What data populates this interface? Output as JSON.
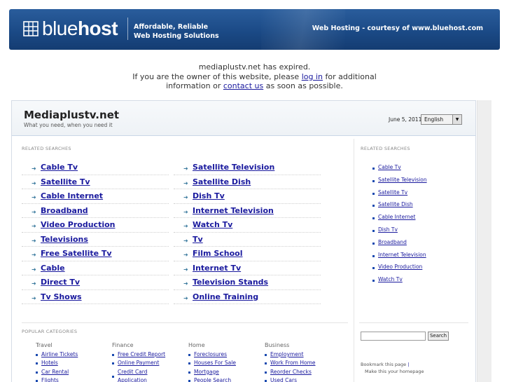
{
  "banner": {
    "logo_light": "blue",
    "logo_bold": "host",
    "tagline_line1": "Affordable, Reliable",
    "tagline_line2": "Web Hosting Solutions",
    "right_text": "Web Hosting - courtesy of www.bluehost.com"
  },
  "notice": {
    "line1": "mediaplustv.net has expired.",
    "line2_pre": "If you are the owner of this website, please ",
    "login_link": "log in",
    "line2_post": " for additional",
    "line3_pre": "information or ",
    "contact_link": "contact us",
    "line3_post": " as soon as possible."
  },
  "site": {
    "title": "Mediaplustv.net",
    "subtitle": "What you need, when you need it",
    "date": "June 5, 2011",
    "language": "English"
  },
  "related_label": "RELATED SEARCHES",
  "related_left": [
    "Cable Tv",
    "Satellite Tv",
    "Cable Internet",
    "Broadband",
    "Video Production",
    "Televisions",
    "Free Satellite Tv",
    "Cable",
    "Direct Tv",
    "Tv Shows"
  ],
  "related_mid": [
    "Satellite Television",
    "Satellite Dish",
    "Dish Tv",
    "Internet Television",
    "Watch Tv",
    "Tv",
    "Film School",
    "Internet Tv",
    "Television Stands",
    "Online Training"
  ],
  "related_right": [
    "Cable Tv",
    "Satellite Television",
    "Satellite Tv",
    "Satellite Dish",
    "Cable Internet",
    "Dish Tv",
    "Broadband",
    "Internet Television",
    "Video Production",
    "Watch Tv"
  ],
  "popular_label": "POPULAR CATEGORIES",
  "categories": [
    {
      "title": "Travel",
      "items": [
        "Airline Tickets",
        "Hotels",
        "Car Rental",
        "Flights"
      ]
    },
    {
      "title": "Finance",
      "items": [
        "Free Credit Report",
        "Online Payment",
        "Credit Card Application"
      ]
    },
    {
      "title": "Home",
      "items": [
        "Foreclosures",
        "Houses For Sale",
        "Mortgage",
        "People Search"
      ]
    },
    {
      "title": "Business",
      "items": [
        "Employment",
        "Work From Home",
        "Reorder Checks",
        "Used Cars"
      ]
    }
  ],
  "search_button": "Search",
  "bookmark": "Bookmark this page",
  "homepage": "Make this your homepage"
}
